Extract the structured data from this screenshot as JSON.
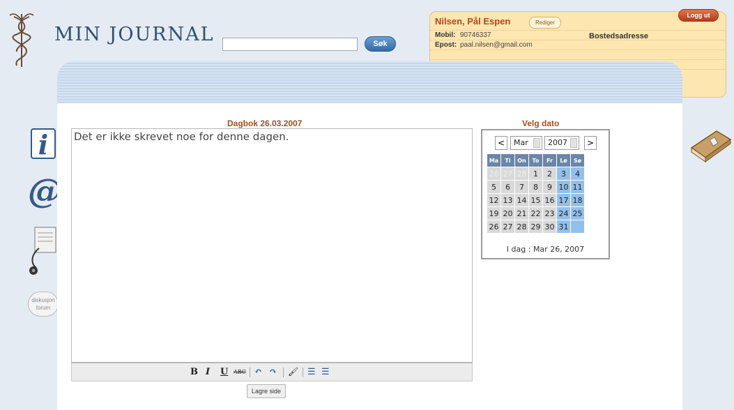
{
  "logo": {
    "text": "MIN JOURNAL"
  },
  "search": {
    "placeholder": "",
    "value": "",
    "button_label": "Søk"
  },
  "user": {
    "name": "Nilsen, Pål Espen",
    "edit_label": "Rediger",
    "logout_label": "Logg ut",
    "mobile_label": "Mobil:",
    "mobile_value": "90746337",
    "email_label": "Epost:",
    "email_value": "paal.nilsen@gmail.com",
    "address_label": "Bostedsadresse"
  },
  "diary": {
    "title": "Dagbok 26.03.2007",
    "content": "Det er ikke skrevet noe for denne dagen.",
    "save_label": "Lagre side",
    "toolbar": {
      "bold": "B",
      "italic": "I",
      "underline": "U",
      "strike": "ABC",
      "undo": "↶",
      "redo": "↷",
      "clean": "🖌",
      "ul": "☰",
      "ol": "☰"
    }
  },
  "calendar": {
    "title": "Velg dato",
    "prev": "<",
    "next": ">",
    "month": "Mar",
    "year": "2007",
    "weekdays": [
      "Ma",
      "Ti",
      "On",
      "To",
      "Fr",
      "Lø",
      "Sø"
    ],
    "weeks": [
      [
        "26",
        "27",
        "28",
        "1",
        "2",
        "3",
        "4"
      ],
      [
        "5",
        "6",
        "7",
        "8",
        "9",
        "10",
        "11"
      ],
      [
        "12",
        "13",
        "14",
        "15",
        "16",
        "17",
        "18"
      ],
      [
        "19",
        "20",
        "21",
        "22",
        "23",
        "24",
        "25"
      ],
      [
        "26",
        "27",
        "28",
        "29",
        "30",
        "31",
        ""
      ]
    ],
    "muted_first_row_count": 3,
    "today_text": "I dag : Mar 26, 2007"
  },
  "side": {
    "info_glyph": "i",
    "at_glyph": "@",
    "forum_text": "diskusjon forum"
  },
  "colors": {
    "accent_brown": "#a0501d",
    "user_name": "#b5451b",
    "header_blue": "#6b86a8",
    "weekend_blue": "#92c0ec"
  }
}
